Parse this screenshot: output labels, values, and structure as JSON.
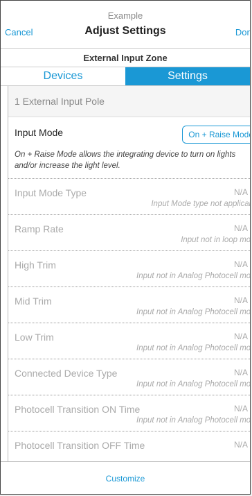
{
  "nav": {
    "subtitle": "Example",
    "title": "Adjust Settings",
    "cancel": "Cancel",
    "done": "Done"
  },
  "zone": {
    "title": "External Input Zone"
  },
  "tabs": [
    {
      "label": "Devices",
      "active": false
    },
    {
      "label": "Settings",
      "active": true
    }
  ],
  "content": {
    "pole": "1 External Input Pole",
    "input_mode": {
      "label": "Input Mode",
      "value": "On + Raise Mode",
      "description": "On + Raise Mode allows the integrating device to turn on lights and/or increase the light level."
    },
    "rows": [
      {
        "label": "Input Mode Type",
        "value": "N/A",
        "note": "Input Mode type not applicable"
      },
      {
        "label": "Ramp Rate",
        "value": "N/A",
        "note": "Input not in loop mode"
      },
      {
        "label": "High Trim",
        "value": "N/A",
        "note": "Input not in Analog Photocell mode"
      },
      {
        "label": "Mid Trim",
        "value": "N/A",
        "note": "Input not in Analog Photocell mode"
      },
      {
        "label": "Low Trim",
        "value": "N/A",
        "note": "Input not in Analog Photocell mode"
      },
      {
        "label": "Connected Device Type",
        "value": "N/A",
        "note": "Input not in Analog Photocell mode"
      },
      {
        "label": "Photocell Transition ON Time",
        "value": "N/A",
        "note": "Input not in Analog Photocell mode"
      },
      {
        "label": "Photocell Transition OFF Time",
        "value": "N/A",
        "note": ""
      }
    ]
  },
  "footer": {
    "label": "Customize"
  },
  "colors": {
    "accent": "#1a98d5"
  }
}
